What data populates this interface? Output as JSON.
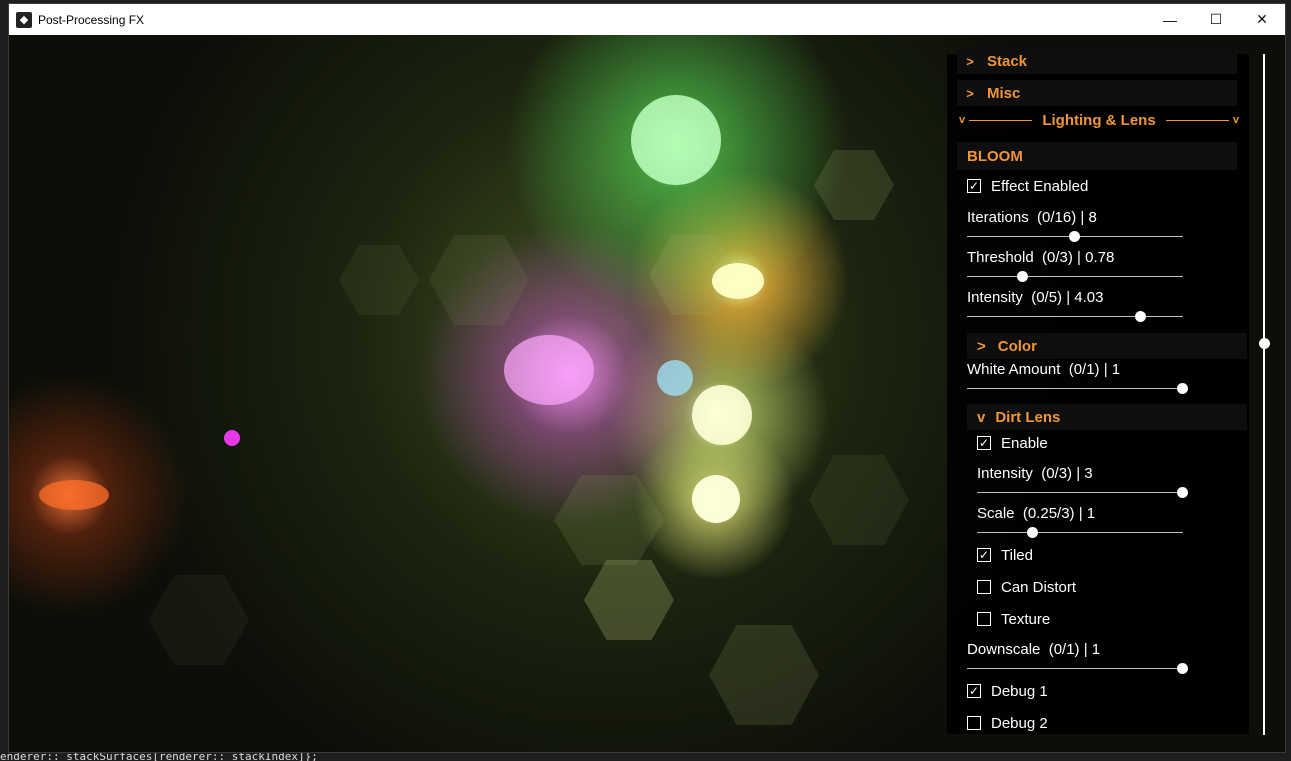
{
  "window": {
    "title": "Post-Processing FX",
    "minimize": "—",
    "maximize": "☐",
    "close": "✕"
  },
  "editor": {
    "bottom_line": "enderer::_stackSurfaces[renderer::_stackIndex]};"
  },
  "panel": {
    "stack": {
      "chevron": ">",
      "label": "Stack"
    },
    "misc": {
      "chevron": ">",
      "label": "Misc"
    },
    "lighting": {
      "left": "v",
      "label": "Lighting & Lens",
      "right": "v"
    },
    "bloom": {
      "label": "BLOOM"
    },
    "effect_enabled": {
      "label": "Effect Enabled",
      "checked": true
    },
    "iterations": {
      "label": "Iterations  (0/16) | 8",
      "value": 8,
      "min": 0,
      "max": 16
    },
    "threshold": {
      "label": "Threshold  (0/3) | 0.78",
      "value": 0.78,
      "min": 0,
      "max": 3
    },
    "intensity": {
      "label": "Intensity  (0/5) | 4.03",
      "value": 4.03,
      "min": 0,
      "max": 5
    },
    "color": {
      "chevron": ">",
      "label": "Color"
    },
    "white_amount": {
      "label": "White Amount  (0/1) | 1",
      "value": 1,
      "min": 0,
      "max": 1
    },
    "dirt_lens": {
      "chevron": "v",
      "label": "Dirt Lens"
    },
    "enable": {
      "label": "Enable",
      "checked": true
    },
    "dirt_intensity": {
      "label": "Intensity  (0/3) | 3",
      "value": 3,
      "min": 0,
      "max": 3
    },
    "scale": {
      "label": "Scale  (0.25/3) | 1",
      "value": 1,
      "min": 0.25,
      "max": 3
    },
    "tiled": {
      "label": "Tiled",
      "checked": true
    },
    "can_distort": {
      "label": "Can Distort",
      "checked": false
    },
    "texture": {
      "label": "Texture",
      "checked": false
    },
    "downscale": {
      "label": "Downscale  (0/1) | 1",
      "value": 1,
      "min": 0,
      "max": 1
    },
    "debug1": {
      "label": "Debug 1",
      "checked": true
    },
    "debug2": {
      "label": "Debug 2",
      "checked": false
    },
    "scroll_position": 0.43,
    "accent_color": "#f0953a"
  }
}
